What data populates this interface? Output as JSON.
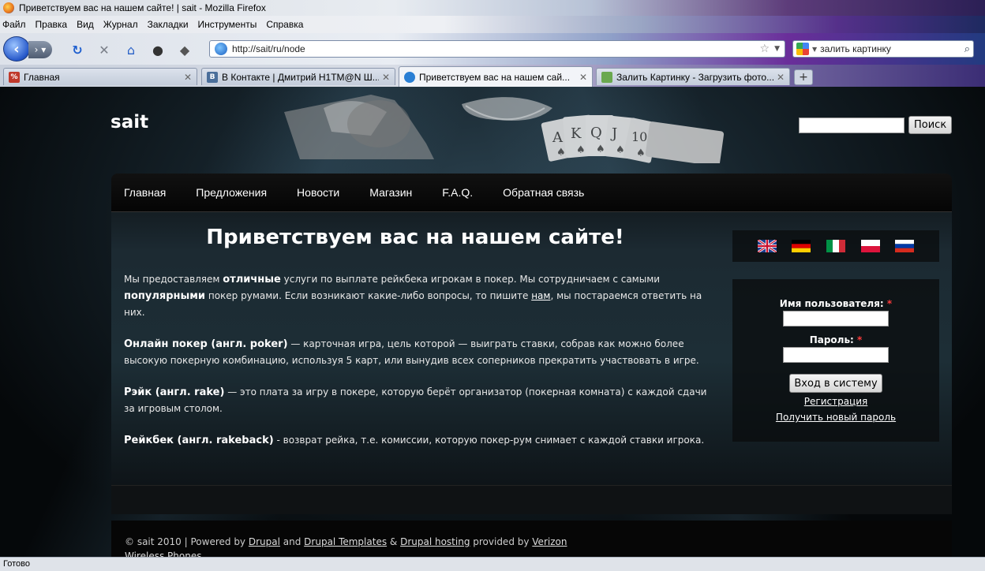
{
  "window": {
    "title": "Приветствуем вас на нашем сайте! | sait - Mozilla Firefox"
  },
  "menubar": {
    "items": [
      "Файл",
      "Правка",
      "Вид",
      "Журнал",
      "Закладки",
      "Инструменты",
      "Справка"
    ]
  },
  "toolbar": {
    "url": "http://sait/ru/node",
    "search_value": "залить картинку"
  },
  "tabs": [
    {
      "label": "Главная",
      "favicon_text": "%",
      "favicon_color": "#c0392b"
    },
    {
      "label": "В Контакте | Дмитрий H1TM@N Ш...",
      "favicon_text": "B",
      "favicon_color": "#4a6e9a"
    },
    {
      "label": "Приветствуем вас на нашем сай...",
      "favicon_text": "",
      "favicon_color": "#2a7fd4"
    },
    {
      "label": "Залить Картинку - Загрузить фото...",
      "favicon_text": "",
      "favicon_color": "#6aa84f"
    }
  ],
  "site": {
    "name": "sait",
    "search_button": "Поиск",
    "nav": [
      "Главная",
      "Предложения",
      "Новости",
      "Магазин",
      "F.A.Q.",
      "Обратная связь"
    ],
    "headline": "Приветствуем вас на нашем сайте!",
    "p1": {
      "a": "Мы предоставляем ",
      "b": "отличные",
      "c": " услуги по выплате рейкбека игрокам в покер.  Мы сотрудничаем с самыми ",
      "d": "популярными",
      "e": " покер румами. Если возникают какие-либо вопросы, то пишите ",
      "link": "нам",
      "f": ", мы постараемся ответить на них."
    },
    "p2": {
      "term": "Онлайн покер (англ. poker)",
      "text": " — карточная игра, цель которой — выиграть ставки, собрав как можно более высокую покерную комбинацию, используя 5 карт, или вынудив всех соперников прекратить участвовать в игре."
    },
    "p3": {
      "term": "Рэйк (англ. rake)",
      "text": " — это плата за игру в покере, которую берёт организатор (покерная комната) с каждой сдачи за игровым столом."
    },
    "p4": {
      "term": "Рейкбек (англ. rakeback)",
      "text": " - возврат рейка, т.е. комиссии, которую покер-рум снимает с каждой ставки игрока."
    },
    "login": {
      "username_label": "Имя пользователя:",
      "password_label": "Пароль:",
      "required_mark": "*",
      "submit": "Вход в систему",
      "register": "Регистрация",
      "new_password": "Получить новый пароль"
    },
    "footer": {
      "copy": "© sait 2010 | Powered by ",
      "drupal": "Drupal",
      "and": " and ",
      "templates": "Drupal Templates",
      "amp": " & ",
      "hosting": "Drupal hosting",
      "provided": " provided by ",
      "verizon": "Verizon",
      "wireless": "Wireless Phones"
    }
  },
  "status": "Готово"
}
